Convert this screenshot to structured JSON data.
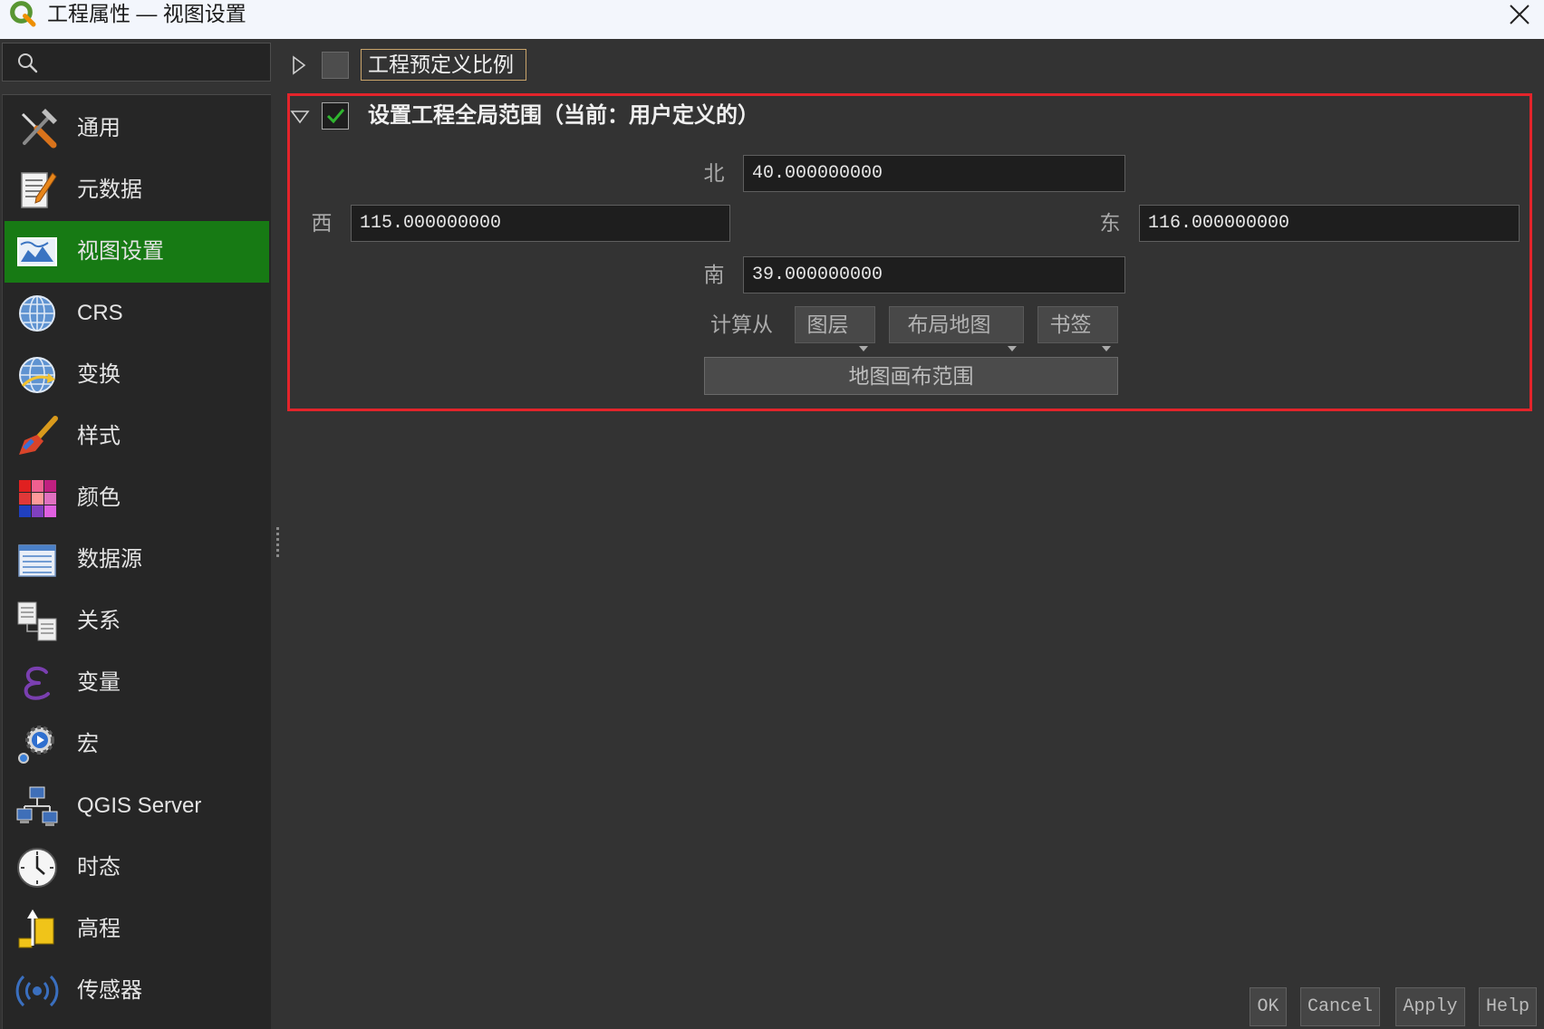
{
  "window": {
    "title": "工程属性 — 视图设置",
    "app_icon": "qgis-logo-icon",
    "close_icon": "close-icon"
  },
  "search": {
    "icon": "search-icon"
  },
  "sidebar": {
    "items": [
      {
        "label": "通用",
        "icon": "tools-icon",
        "selected": false
      },
      {
        "label": "元数据",
        "icon": "document-pencil-icon",
        "selected": false
      },
      {
        "label": "视图设置",
        "icon": "map-view-icon",
        "selected": true
      },
      {
        "label": "CRS",
        "icon": "globe-icon",
        "selected": false
      },
      {
        "label": "变换",
        "icon": "globe-transform-icon",
        "selected": false
      },
      {
        "label": "样式",
        "icon": "paintbrush-icon",
        "selected": false
      },
      {
        "label": "颜色",
        "icon": "color-palette-icon",
        "selected": false
      },
      {
        "label": "数据源",
        "icon": "data-source-icon",
        "selected": false
      },
      {
        "label": "关系",
        "icon": "relations-icon",
        "selected": false
      },
      {
        "label": "变量",
        "icon": "epsilon-icon",
        "selected": false
      },
      {
        "label": "宏",
        "icon": "macro-gear-icon",
        "selected": false
      },
      {
        "label": "QGIS Server",
        "icon": "server-network-icon",
        "selected": false
      },
      {
        "label": "时态",
        "icon": "clock-icon",
        "selected": false
      },
      {
        "label": "高程",
        "icon": "elevation-icon",
        "selected": false
      },
      {
        "label": "传感器",
        "icon": "sensor-icon",
        "selected": false
      }
    ]
  },
  "scales_group": {
    "label": "工程预定义比例",
    "checked": false,
    "expanded": false
  },
  "extent_group": {
    "label": "设置工程全局范围（当前：用户定义的）",
    "checked": true,
    "expanded": true,
    "north": {
      "label": "北",
      "value": "40.000000000"
    },
    "west": {
      "label": "西",
      "value": "115.000000000"
    },
    "east": {
      "label": "东",
      "value": "116.000000000"
    },
    "south": {
      "label": "南",
      "value": "39.000000000"
    },
    "calculate_from": {
      "label": "计算从",
      "layer_button": "图层",
      "layout_map_button": "布局地图",
      "bookmark_button": "书签"
    },
    "map_canvas_extent_button": "地图画布范围"
  },
  "dialog_buttons": {
    "ok": "OK",
    "cancel": "Cancel",
    "apply": "Apply",
    "help": "Help"
  },
  "colors": {
    "selected_item_bg": "#177a14",
    "highlight_box": "#e3242b",
    "check_mark": "#2fb52f",
    "focus_border": "#c9a46a",
    "background": "#333333"
  }
}
